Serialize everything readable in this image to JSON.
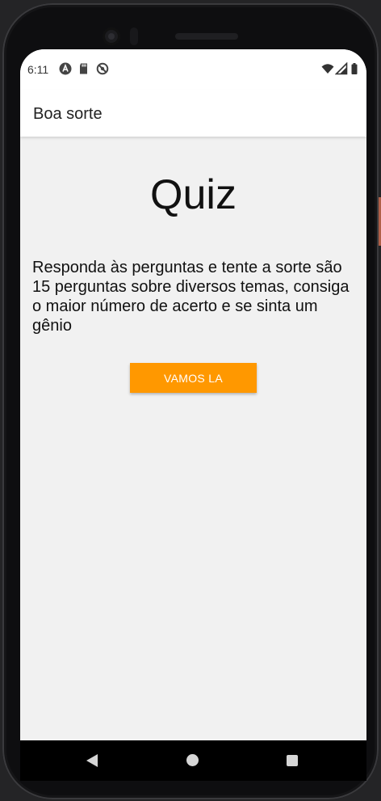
{
  "status_bar": {
    "time": "6:11",
    "left_icons": [
      "app-a-icon",
      "sd-card-icon",
      "sync-off-icon"
    ],
    "right_icons": [
      "wifi-icon",
      "signal-icon",
      "battery-icon"
    ]
  },
  "app_bar": {
    "title": "Boa sorte"
  },
  "main": {
    "title": "Quiz",
    "description": "Responda às perguntas e tente a sorte são 15 perguntas sobre diversos temas, consiga o maior número de acerto e se sinta um gênio",
    "start_button_label": "VAMOS LA"
  },
  "nav_bar": {
    "icons": [
      "back-icon",
      "home-icon",
      "recents-icon"
    ]
  },
  "colors": {
    "accent": "#ff9800",
    "screen_background": "#f1f1f1",
    "app_bar_background": "#ffffff"
  }
}
